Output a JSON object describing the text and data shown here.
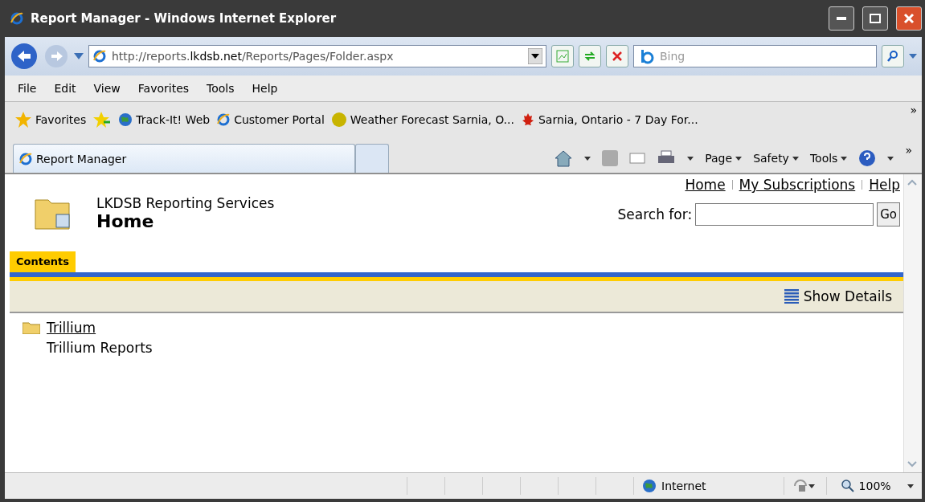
{
  "window": {
    "title": "Report Manager - Windows Internet Explorer"
  },
  "address_bar": {
    "url_prefix": "http://reports.",
    "url_domain": "lkdsb.net",
    "url_path": "/Reports/Pages/Folder.aspx"
  },
  "search_box": {
    "placeholder": "Bing"
  },
  "menu_bar": [
    "File",
    "Edit",
    "View",
    "Favorites",
    "Tools",
    "Help"
  ],
  "favorites_bar": {
    "label": "Favorites",
    "items": [
      {
        "label": "Track-It! Web",
        "kind": "globe"
      },
      {
        "label": "Customer Portal",
        "kind": "ie"
      },
      {
        "label": "Weather Forecast Sarnia, O...",
        "kind": "weather"
      },
      {
        "label": "Sarnia, Ontario - 7 Day For...",
        "kind": "leaf"
      }
    ],
    "overflow": "»"
  },
  "tabs": [
    {
      "label": "Report Manager",
      "selected": true
    }
  ],
  "command_bar": {
    "items": [
      {
        "label": "Page"
      },
      {
        "label": "Safety"
      },
      {
        "label": "Tools"
      }
    ],
    "overflow": "»"
  },
  "page": {
    "links": [
      "Home",
      "My Subscriptions",
      "Help"
    ],
    "site_title": "LKDSB Reporting Services",
    "heading": "Home",
    "search_label": "Search for:",
    "search_button": "Go",
    "page_tabs": [
      {
        "label": "Contents",
        "selected": true
      }
    ],
    "toolbar_action": "Show Details",
    "folders": [
      {
        "name": "Trillium",
        "description": "Trillium Reports"
      }
    ]
  },
  "status_bar": {
    "zone": "Internet",
    "zoom": "100%"
  }
}
